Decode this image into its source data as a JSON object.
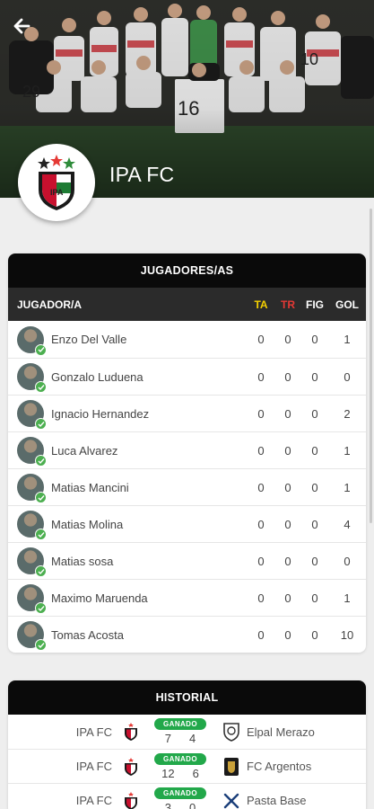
{
  "header": {
    "team_name": "IPA FC"
  },
  "players_card": {
    "title": "JUGADORES/AS",
    "columns": {
      "player": "JUGADOR/A",
      "ta": "TA",
      "tr": "TR",
      "fig": "FIG",
      "gol": "GOL"
    },
    "column_colors": {
      "ta": "#f5d000",
      "tr": "#e53935"
    },
    "rows": [
      {
        "name": "Enzo Del Valle",
        "ta": "0",
        "tr": "0",
        "fig": "0",
        "gol": "1"
      },
      {
        "name": "Gonzalo Luduena",
        "ta": "0",
        "tr": "0",
        "fig": "0",
        "gol": "0"
      },
      {
        "name": "Ignacio Hernandez",
        "ta": "0",
        "tr": "0",
        "fig": "0",
        "gol": "2"
      },
      {
        "name": "Luca Alvarez",
        "ta": "0",
        "tr": "0",
        "fig": "0",
        "gol": "1"
      },
      {
        "name": "Matias Mancini",
        "ta": "0",
        "tr": "0",
        "fig": "0",
        "gol": "1"
      },
      {
        "name": "Matias Molina",
        "ta": "0",
        "tr": "0",
        "fig": "0",
        "gol": "4"
      },
      {
        "name": "Matias sosa",
        "ta": "0",
        "tr": "0",
        "fig": "0",
        "gol": "0"
      },
      {
        "name": "Maximo Maruenda",
        "ta": "0",
        "tr": "0",
        "fig": "0",
        "gol": "1"
      },
      {
        "name": "Tomas Acosta",
        "ta": "0",
        "tr": "0",
        "fig": "0",
        "gol": "10"
      }
    ]
  },
  "history_card": {
    "title": "HISTORIAL",
    "matches": [
      {
        "home": "IPA FC",
        "result": "GANADO",
        "home_score": "7",
        "away_score": "4",
        "away": "Elpal Merazo",
        "away_icon": "shield-crest-icon"
      },
      {
        "home": "IPA FC",
        "result": "GANADO",
        "home_score": "12",
        "away_score": "6",
        "away": "FC Argentos",
        "away_icon": "gold-crest-icon"
      },
      {
        "home": "IPA FC",
        "result": "GANADO",
        "home_score": "3",
        "away_score": "0",
        "away": "Pasta Base",
        "away_icon": "crossed-sticks-icon"
      }
    ]
  },
  "colors": {
    "accent": "#0a0a0a",
    "win": "#22a84a",
    "check": "#4caf50"
  }
}
